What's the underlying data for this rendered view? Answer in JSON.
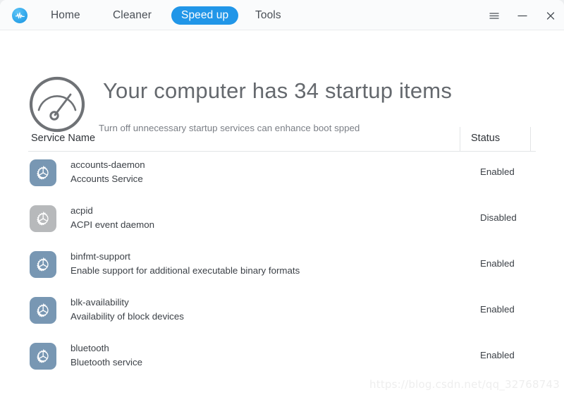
{
  "window": {
    "brand_icon": "waveform-logo-icon",
    "controls": [
      {
        "name": "menu-button",
        "icon": "hamburger-menu-icon",
        "label": "≡"
      },
      {
        "name": "minimize-button",
        "icon": "minimize-icon",
        "label": "—"
      },
      {
        "name": "close-button",
        "icon": "close-icon",
        "label": "✕"
      }
    ]
  },
  "nav": {
    "items": [
      {
        "label": "Home",
        "active": false
      },
      {
        "label": "Cleaner",
        "active": false
      },
      {
        "label": "Speed up",
        "active": true
      },
      {
        "label": "Tools",
        "active": false
      }
    ],
    "active_color": "#2196e8"
  },
  "hero": {
    "icon": "speedometer-gauge-icon",
    "title": "Your computer has 34 startup items",
    "subtitle": "Turn off unnecessary startup services can enhance boot spped",
    "startup_item_count": "34"
  },
  "table": {
    "columns": [
      {
        "key": "service_name",
        "label": "Service Name"
      },
      {
        "key": "status",
        "label": "Status"
      }
    ],
    "rows": [
      {
        "icon": "gear-icon",
        "name": "accounts-daemon",
        "description": "Accounts Service",
        "status": "Enabled"
      },
      {
        "icon": "gear-icon",
        "name": "acpid",
        "description": "ACPI event daemon",
        "status": "Disabled"
      },
      {
        "icon": "gear-icon",
        "name": "binfmt-support",
        "description": "Enable support for additional executable binary formats",
        "status": "Enabled"
      },
      {
        "icon": "gear-icon",
        "name": "blk-availability",
        "description": "Availability of block devices",
        "status": "Enabled"
      },
      {
        "icon": "gear-icon",
        "name": "bluetooth",
        "description": "Bluetooth service",
        "status": "Enabled"
      }
    ]
  },
  "colors": {
    "accent": "#2196e8",
    "icon_enabled": "#7897b3",
    "icon_disabled": "#b7b9bb",
    "title_text": "#65696e",
    "body_text": "#3c4147"
  },
  "watermark": {
    "text": "https://blog.csdn.net/qq_32768743"
  }
}
